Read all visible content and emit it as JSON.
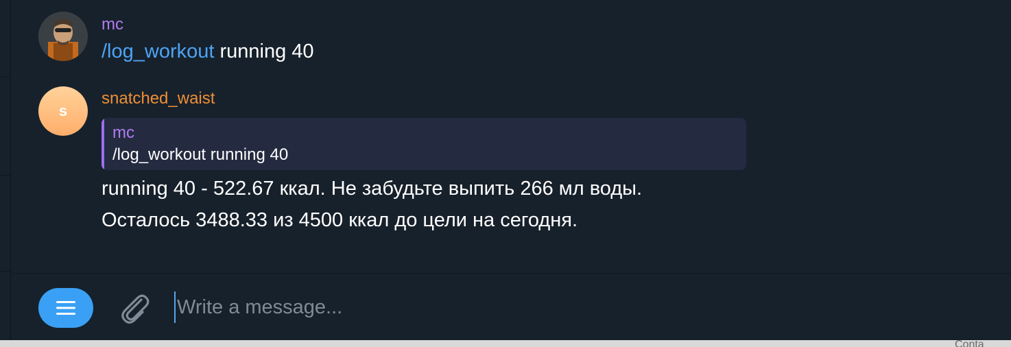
{
  "messages": [
    {
      "sender": "mc",
      "command": "/log_workout",
      "text_rest": " running 40"
    },
    {
      "sender": "snatched_waist",
      "avatar_letter": "s",
      "reply": {
        "sender": "mc",
        "text": "/log_workout running 40"
      },
      "lines": [
        "running 40 - 522.67 ккал. Не забудьте выпить 266 мл воды.",
        "Осталось 3488.33 из 4500 ккал до цели на сегодня."
      ]
    }
  ],
  "composer": {
    "placeholder": "Write a message..."
  },
  "bottom_strip_text": "Conta",
  "colors": {
    "background": "#17212b",
    "mc_name": "#b07cf0",
    "bot_name": "#ef8f36",
    "link": "#4ea4f6",
    "reply_bg": "#242b40",
    "reply_bar": "#9d6ef2",
    "menu_button": "#3aa0f5"
  },
  "icons": {
    "menu": "menu-icon",
    "attach": "paperclip-icon"
  }
}
